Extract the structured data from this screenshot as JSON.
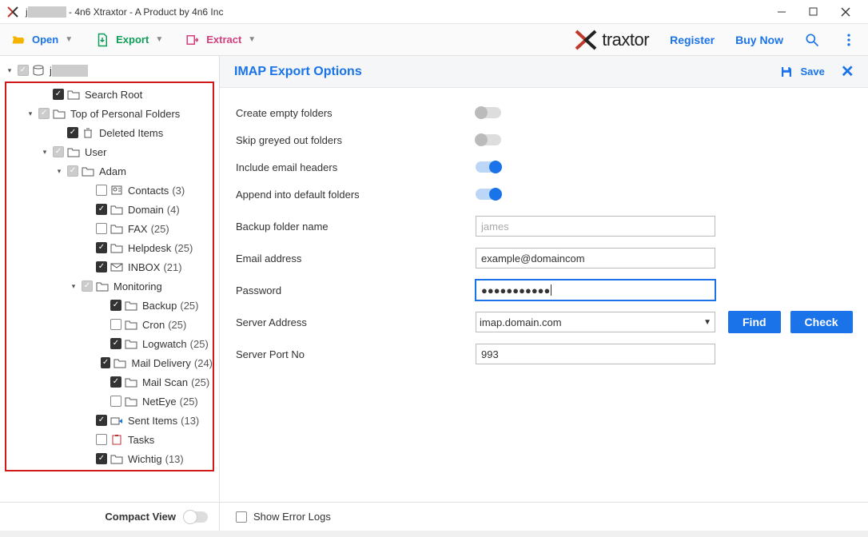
{
  "window": {
    "title_prefix": "j",
    "title_suffix": " - 4n6 Xtraxtor - A Product by 4n6 Inc"
  },
  "toolbar": {
    "open": "Open",
    "export": "Export",
    "extract": "Extract",
    "brand": "traxtor",
    "register": "Register",
    "buy_now": "Buy Now"
  },
  "tree": {
    "root": {
      "label": "j",
      "expanded": true,
      "checked": "greyed"
    },
    "items": [
      {
        "indent": 2,
        "expander": "",
        "checked": true,
        "icon": "folder",
        "label": "Search Root",
        "count": null
      },
      {
        "indent": 1,
        "expander": "down",
        "checked": "greyed",
        "icon": "folder",
        "label": "Top of Personal Folders",
        "count": null
      },
      {
        "indent": 3,
        "expander": "",
        "checked": true,
        "icon": "trash",
        "label": "Deleted Items",
        "count": null
      },
      {
        "indent": 2,
        "expander": "down",
        "checked": "greyed",
        "icon": "folder",
        "label": "User",
        "count": null
      },
      {
        "indent": 3,
        "expander": "down",
        "checked": "greyed",
        "icon": "folder",
        "label": "Adam",
        "count": null
      },
      {
        "indent": 5,
        "expander": "",
        "checked": false,
        "icon": "contacts",
        "label": "Contacts",
        "count": "(3)"
      },
      {
        "indent": 5,
        "expander": "",
        "checked": true,
        "icon": "folder",
        "label": "Domain",
        "count": "(4)"
      },
      {
        "indent": 5,
        "expander": "",
        "checked": false,
        "icon": "folder",
        "label": "FAX",
        "count": "(25)"
      },
      {
        "indent": 5,
        "expander": "",
        "checked": true,
        "icon": "folder",
        "label": "Helpdesk",
        "count": "(25)"
      },
      {
        "indent": 5,
        "expander": "",
        "checked": true,
        "icon": "mail",
        "label": "INBOX",
        "count": "(21)"
      },
      {
        "indent": 4,
        "expander": "down",
        "checked": "greyed",
        "icon": "folder",
        "label": "Monitoring",
        "count": null
      },
      {
        "indent": 6,
        "expander": "",
        "checked": true,
        "icon": "folder",
        "label": "Backup",
        "count": "(25)"
      },
      {
        "indent": 6,
        "expander": "",
        "checked": false,
        "icon": "folder",
        "label": "Cron",
        "count": "(25)"
      },
      {
        "indent": 6,
        "expander": "",
        "checked": true,
        "icon": "folder",
        "label": "Logwatch",
        "count": "(25)"
      },
      {
        "indent": 6,
        "expander": "",
        "checked": true,
        "icon": "folder",
        "label": "Mail Delivery",
        "count": "(24)"
      },
      {
        "indent": 6,
        "expander": "",
        "checked": true,
        "icon": "folder",
        "label": "Mail Scan",
        "count": "(25)"
      },
      {
        "indent": 6,
        "expander": "",
        "checked": false,
        "icon": "folder",
        "label": "NetEye",
        "count": "(25)"
      },
      {
        "indent": 5,
        "expander": "",
        "checked": true,
        "icon": "sent",
        "label": "Sent Items",
        "count": "(13)"
      },
      {
        "indent": 5,
        "expander": "",
        "checked": false,
        "icon": "tasks",
        "label": "Tasks",
        "count": null
      },
      {
        "indent": 5,
        "expander": "",
        "checked": true,
        "icon": "folder",
        "label": "Wichtig",
        "count": "(13)"
      }
    ]
  },
  "sidebar_footer": {
    "compact_view": "Compact View"
  },
  "panel": {
    "title": "IMAP Export Options",
    "save": "Save"
  },
  "form": {
    "create_empty": {
      "label": "Create empty folders",
      "on": false
    },
    "skip_greyed": {
      "label": "Skip greyed out folders",
      "on": false
    },
    "include_headers": {
      "label": "Include email headers",
      "on": true
    },
    "append_default": {
      "label": "Append into default folders",
      "on": true
    },
    "backup_name": {
      "label": "Backup folder name",
      "placeholder": "james",
      "value": ""
    },
    "email": {
      "label": "Email address",
      "value": "example@domaincom"
    },
    "password": {
      "label": "Password",
      "value": "●●●●●●●●●●●"
    },
    "server_addr": {
      "label": "Server Address",
      "value": "imap.domain.com"
    },
    "server_port": {
      "label": "Server Port No",
      "value": "993"
    },
    "find": "Find",
    "check": "Check"
  },
  "content_footer": {
    "show_error_logs": "Show Error Logs"
  }
}
